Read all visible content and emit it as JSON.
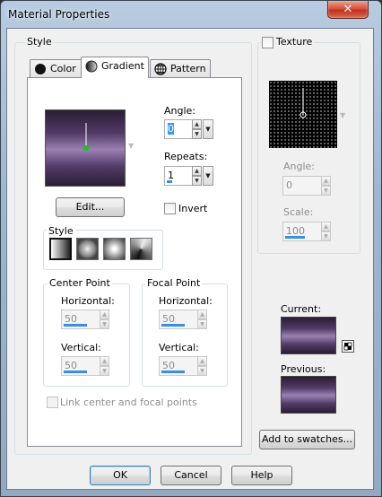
{
  "window": {
    "title": "Material Properties",
    "close_glyph": "✕"
  },
  "style_group": {
    "label": "Style",
    "tabs": [
      {
        "label": "Color",
        "icon": "circle-icon"
      },
      {
        "label": "Gradient",
        "icon": "half-circle-icon"
      },
      {
        "label": "Pattern",
        "icon": "globe-icon"
      }
    ],
    "active_tab": "Gradient",
    "angle": {
      "label": "Angle:",
      "value": "0"
    },
    "repeats": {
      "label": "Repeats:",
      "value": "1"
    },
    "edit_label": "Edit...",
    "invert_label": "Invert",
    "invert_checked": false,
    "gradient_style": {
      "label": "Style",
      "options": [
        "linear-style-icon",
        "rectangular-style-icon",
        "sunburst-style-icon",
        "radial-style-icon"
      ],
      "selected_index": 0
    },
    "center_point": {
      "label": "Center Point",
      "horizontal_label": "Horizontal:",
      "horizontal_value": "50",
      "vertical_label": "Vertical:",
      "vertical_value": "50"
    },
    "focal_point": {
      "label": "Focal Point",
      "horizontal_label": "Horizontal:",
      "horizontal_value": "50",
      "vertical_label": "Vertical:",
      "vertical_value": "50"
    },
    "link_points_label": "Link center and focal points",
    "link_points_checked": false
  },
  "texture": {
    "label": "Texture",
    "checked": false,
    "angle_label": "Angle:",
    "angle_value": "0",
    "scale_label": "Scale:",
    "scale_value": "100"
  },
  "current_label": "Current:",
  "previous_label": "Previous:",
  "add_swatches_label": "Add to swatches...",
  "buttons": {
    "ok": "OK",
    "cancel": "Cancel",
    "help": "Help"
  },
  "colors": {
    "gradient_dark": "#2a1d33",
    "gradient_light": "#9a80b3",
    "accent_bar": "#3b8fe0"
  }
}
